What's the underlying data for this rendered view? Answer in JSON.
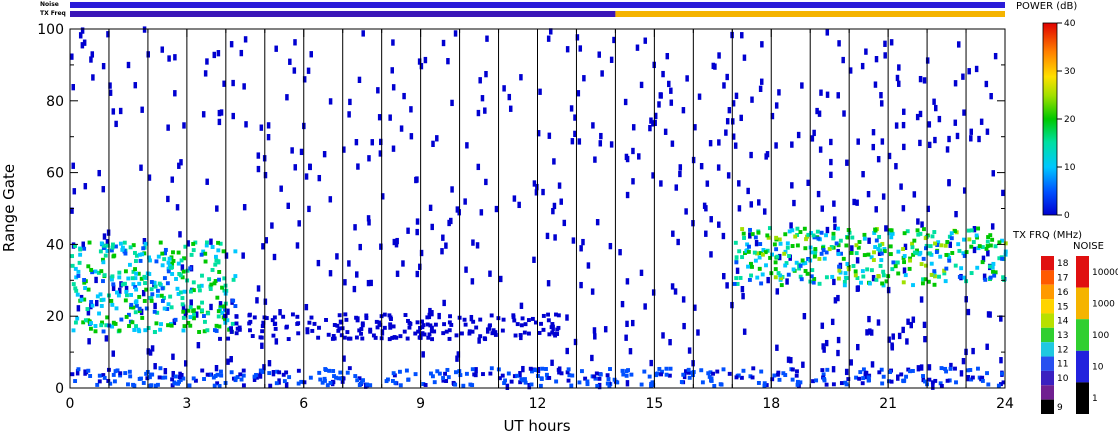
{
  "chart_data": {
    "type": "heatmap",
    "xlabel": "UT hours",
    "ylabel": "Range Gate",
    "xlim": [
      0,
      24
    ],
    "ylim": [
      0,
      100
    ],
    "x_ticks": [
      0,
      3,
      6,
      9,
      12,
      15,
      18,
      21,
      24
    ],
    "y_ticks": [
      0,
      20,
      40,
      60,
      80,
      100
    ],
    "hour_gridlines": [
      1,
      2,
      3,
      4,
      5,
      6,
      7,
      8,
      9,
      10,
      11,
      12,
      13,
      14,
      15,
      16,
      17,
      18,
      19,
      20,
      21,
      22,
      23
    ],
    "status_bars": {
      "noise_label": "Noise",
      "txfreq_label": "TX Freq",
      "noise_segments": [
        {
          "start": 0,
          "end": 24,
          "level": "low",
          "color": "#2a1cd8"
        }
      ],
      "txfreq_segments": [
        {
          "start": 0,
          "end": 14,
          "mhz": 11,
          "color": "#3b16b8"
        },
        {
          "start": 14,
          "end": 24,
          "mhz": 15,
          "color": "#f5b400"
        }
      ]
    },
    "power_colorbar": {
      "title": "POWER (dB)",
      "ticks": [
        0,
        10,
        20,
        30,
        40
      ],
      "range": [
        0,
        40
      ]
    },
    "txfreq_colorbar": {
      "title": "TX FRQ (MHz)",
      "labels": [
        "18",
        "17",
        "16",
        "15",
        "14",
        "13",
        "12",
        "11",
        "10",
        "9"
      ],
      "colors": [
        "#e01010",
        "#ff5a00",
        "#ff9a00",
        "#ffd400",
        "#b8e000",
        "#30cf30",
        "#20c8e0",
        "#2850f0",
        "#3a20c0",
        "#702090",
        "#000000"
      ]
    },
    "noise_colorbar": {
      "title": "NOISE",
      "labels": [
        "10000",
        "1000",
        "100",
        "10",
        "1"
      ],
      "colors": [
        "#e01010",
        "#f5b400",
        "#30cf30",
        "#2222dd",
        "#000000"
      ]
    },
    "features": [
      {
        "description": "ground scatter band near gate 0-5",
        "x_range": [
          0,
          24
        ],
        "gate_range": [
          0,
          5
        ],
        "power_db": 8
      },
      {
        "description": "intense echo band gate 20-40",
        "x_range": [
          0,
          4.2
        ],
        "gate_range": [
          15,
          40
        ],
        "power_db": 20
      },
      {
        "description": "weak band gate 15-20",
        "x_range": [
          3.8,
          12.5
        ],
        "gate_range": [
          13,
          20
        ],
        "power_db": 3
      },
      {
        "description": "intense echo band gate 28-45",
        "x_range": [
          17,
          24
        ],
        "gate_range": [
          28,
          44
        ],
        "power_db": 22
      }
    ]
  }
}
